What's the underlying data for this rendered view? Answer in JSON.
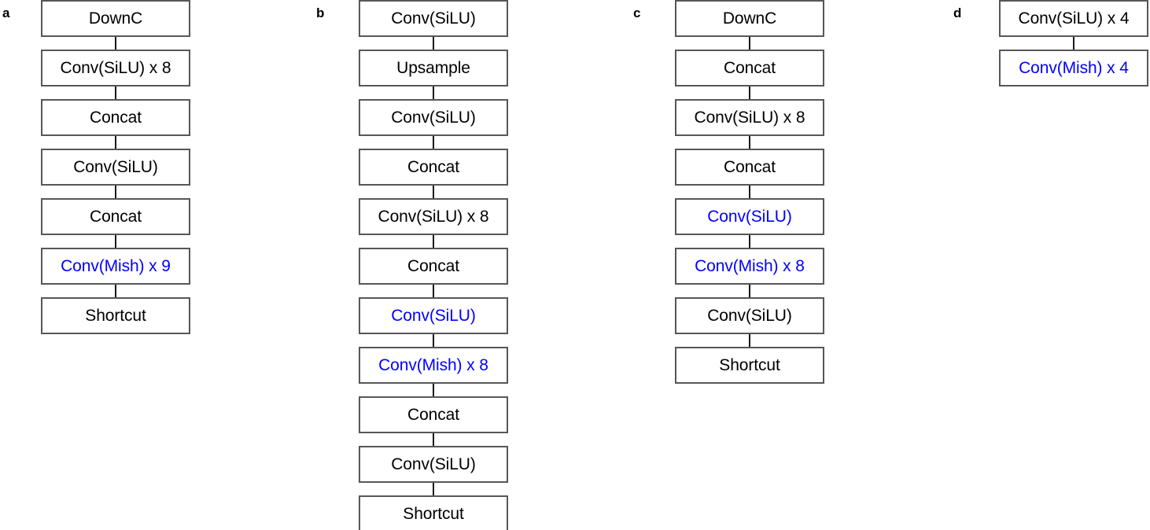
{
  "figure": {
    "type": "neural-network-architecture-block-diagrams",
    "accent_blue": "#0000FF",
    "text_black": "#000000",
    "border_color": "#575757",
    "background": "#FFFFFF"
  },
  "panels": [
    {
      "letter": "a",
      "nodes": [
        {
          "label": "DownC",
          "color": "black"
        },
        {
          "label": "Conv(SiLU) x 8",
          "color": "black"
        },
        {
          "label": "Concat",
          "color": "black"
        },
        {
          "label": "Conv(SiLU)",
          "color": "black"
        },
        {
          "label": "Concat",
          "color": "black"
        },
        {
          "label": "Conv(Mish) x 9",
          "color": "blue"
        },
        {
          "label": "Shortcut",
          "color": "black"
        }
      ]
    },
    {
      "letter": "b",
      "nodes": [
        {
          "label": "Conv(SiLU)",
          "color": "black"
        },
        {
          "label": "Upsample",
          "color": "black"
        },
        {
          "label": "Conv(SiLU)",
          "color": "black"
        },
        {
          "label": "Concat",
          "color": "black"
        },
        {
          "label": "Conv(SiLU) x 8",
          "color": "black"
        },
        {
          "label": "Concat",
          "color": "black"
        },
        {
          "label": "Conv(SiLU)",
          "color": "blue"
        },
        {
          "label": "Conv(Mish) x 8",
          "color": "blue"
        },
        {
          "label": "Concat",
          "color": "black"
        },
        {
          "label": "Conv(SiLU)",
          "color": "black"
        },
        {
          "label": "Shortcut",
          "color": "black"
        }
      ]
    },
    {
      "letter": "c",
      "nodes": [
        {
          "label": "DownC",
          "color": "black"
        },
        {
          "label": "Concat",
          "color": "black"
        },
        {
          "label": "Conv(SiLU) x 8",
          "color": "black"
        },
        {
          "label": "Concat",
          "color": "black"
        },
        {
          "label": "Conv(SiLU)",
          "color": "blue"
        },
        {
          "label": "Conv(Mish) x 8",
          "color": "blue"
        },
        {
          "label": "Conv(SiLU)",
          "color": "black"
        },
        {
          "label": "Shortcut",
          "color": "black"
        }
      ]
    },
    {
      "letter": "d",
      "nodes": [
        {
          "label": "Conv(SiLU) x 4",
          "color": "black"
        },
        {
          "label": "Conv(Mish) x 4",
          "color": "blue"
        }
      ]
    }
  ]
}
